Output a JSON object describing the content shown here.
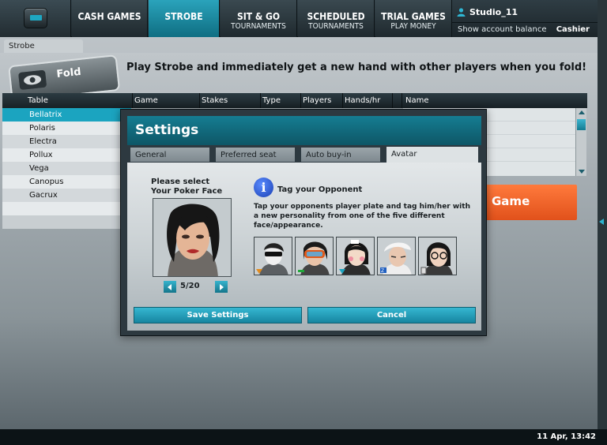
{
  "nav": {
    "tabs": [
      {
        "line1": "CASH GAMES",
        "line2": ""
      },
      {
        "line1": "STROBE",
        "line2": ""
      },
      {
        "line1": "SIT & GO",
        "line2": "TOURNAMENTS"
      },
      {
        "line1": "SCHEDULED",
        "line2": "TOURNAMENTS"
      },
      {
        "line1": "TRIAL GAMES",
        "line2": "PLAY MONEY"
      }
    ],
    "active_tab": "STROBE"
  },
  "account": {
    "username": "Studio_11",
    "show_balance": "Show account balance",
    "cashier": "Cashier"
  },
  "section_tab": "Strobe",
  "promo": {
    "fold_label": "Fold",
    "headline": "Play Strobe and immediately get a new hand with other players when you fold!"
  },
  "table_list": {
    "columns": [
      "Table",
      "Game",
      "Stakes",
      "Type",
      "Players",
      "Hands/hr",
      "Name"
    ],
    "rows": [
      "Bellatrix",
      "Polaris",
      "Electra",
      "Pollux",
      "Vega",
      "Canopus",
      "Gacrux"
    ],
    "selected": "Bellatrix"
  },
  "game_button": "Game",
  "dialog": {
    "title": "Settings",
    "tabs": [
      "General",
      "Preferred seat",
      "Auto buy-in",
      "Avatar"
    ],
    "active_tab": "Avatar",
    "poker_face_label_1": "Please select",
    "poker_face_label_2": "Your Poker Face",
    "pager": "5/20",
    "tag_title": "Tag your Opponent",
    "tag_desc": "Tap your opponents player plate and tag him/her with a new personality from one of the five different face/appearance.",
    "save": "Save Settings",
    "cancel": "Cancel"
  },
  "status_bar": {
    "datetime": "11 Apr, 13:42"
  },
  "colors": {
    "accent": "#1ba4c0",
    "game_button": "#e9602a",
    "dialog_title": "#137589"
  }
}
